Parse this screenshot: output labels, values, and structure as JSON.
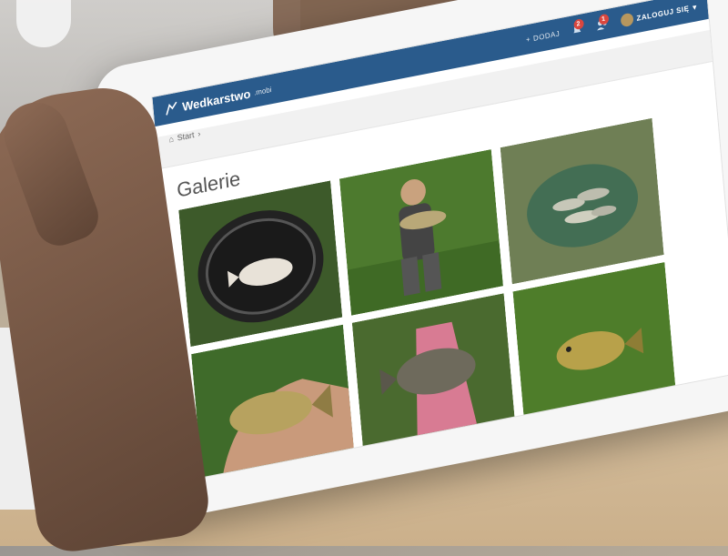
{
  "site": {
    "logo_text": "Wedkarstwo",
    "logo_suffix": ".mobi"
  },
  "navbar": {
    "add_label": "DODAJ",
    "notification_badge_1": "2",
    "notification_badge_2": "1",
    "login_label": "ZALOGUJ SIĘ"
  },
  "breadcrumb": {
    "home_label": "Start"
  },
  "page": {
    "title": "Galerie"
  },
  "gallery": {
    "photos": [
      {
        "subject": "fish in landing net"
      },
      {
        "subject": "angler holding fish"
      },
      {
        "subject": "catch in keep net"
      },
      {
        "subject": "fish held in hand"
      },
      {
        "subject": "fish in gloved hand"
      },
      {
        "subject": "fish on grass"
      }
    ]
  },
  "colors": {
    "navbar": "#2a5b8c",
    "badge": "#d9463e",
    "accent_text": "#555555"
  }
}
